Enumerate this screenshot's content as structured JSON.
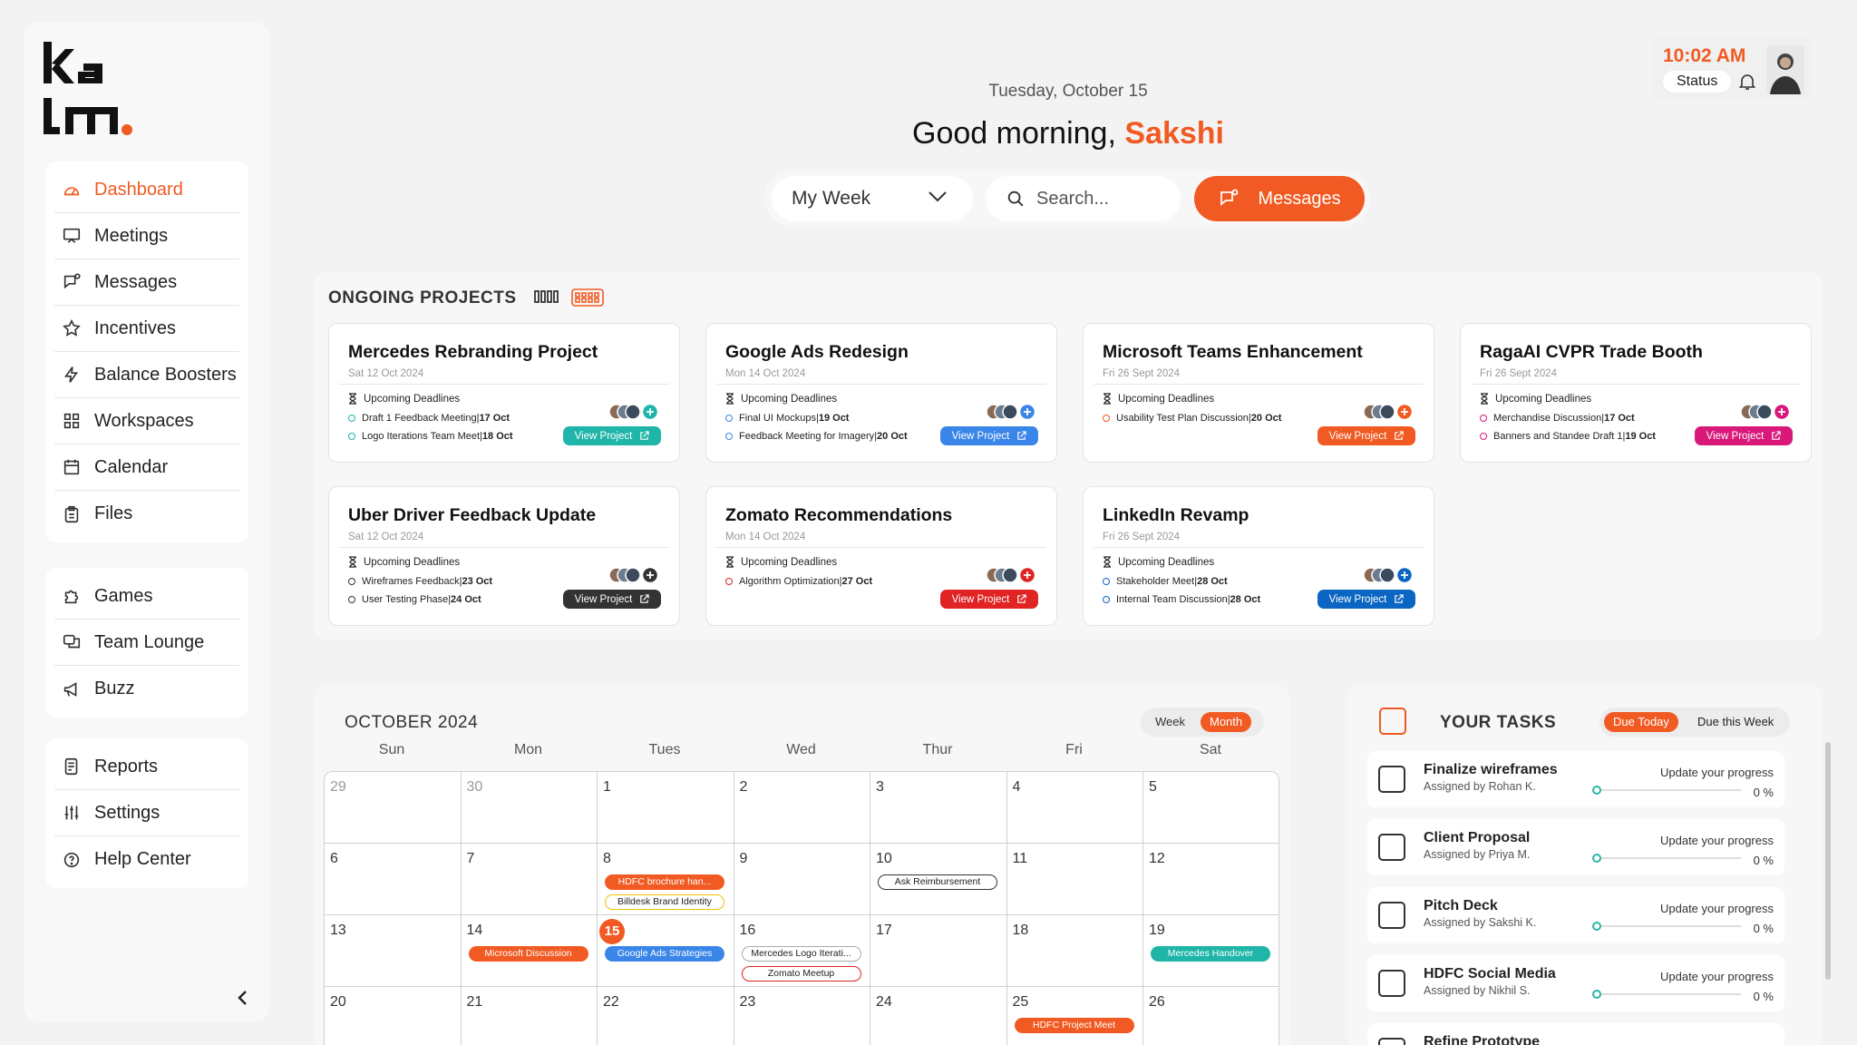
{
  "brand": {
    "logo_text_top": "ka",
    "logo_text_bottom": "lm",
    "accent": "#f15a22"
  },
  "sidebar": {
    "group1": [
      {
        "label": "Dashboard",
        "icon": "dashboard-icon",
        "active": true
      },
      {
        "label": "Meetings",
        "icon": "meetings-icon"
      },
      {
        "label": "Messages",
        "icon": "messages-icon"
      },
      {
        "label": "Incentives",
        "icon": "star-icon"
      },
      {
        "label": "Balance Boosters",
        "icon": "bolt-icon"
      },
      {
        "label": "Workspaces",
        "icon": "grid-icon"
      },
      {
        "label": "Calendar",
        "icon": "calendar-icon"
      },
      {
        "label": "Files",
        "icon": "files-icon"
      }
    ],
    "group2": [
      {
        "label": "Games",
        "icon": "puzzle-icon"
      },
      {
        "label": "Team Lounge",
        "icon": "lounge-icon"
      },
      {
        "label": "Buzz",
        "icon": "megaphone-icon"
      }
    ],
    "group3": [
      {
        "label": "Reports",
        "icon": "reports-icon"
      },
      {
        "label": "Settings",
        "icon": "sliders-icon"
      },
      {
        "label": "Help Center",
        "icon": "help-icon"
      }
    ]
  },
  "header": {
    "date": "Tuesday, October 15",
    "greeting": "Good morning,",
    "name": "Sakshi",
    "week_select": "My Week",
    "search_placeholder": "Search...",
    "messages_button": "Messages",
    "time": "10:02 AM",
    "status": "Status"
  },
  "projects": {
    "heading": "ONGOING PROJECTS",
    "upcoming_label": "Upcoming Deadlines",
    "view_label": "View Project",
    "cards": [
      {
        "title": "Mercedes Rebranding Project",
        "date": "Sat  12 Oct 2024",
        "color": "#1fb5a8",
        "dot": "#1fb5a8",
        "deadlines": [
          [
            "Draft 1 Feedback Meeting",
            "17 Oct"
          ],
          [
            "Logo Iterations Team Meet",
            "18 Oct"
          ]
        ]
      },
      {
        "title": "Google Ads Redesign",
        "date": "Mon  14 Oct 2024",
        "color": "#3a86e8",
        "dot": "#3a86e8",
        "deadlines": [
          [
            "Final UI Mockups",
            "19 Oct"
          ],
          [
            "Feedback Meeting for Imagery",
            "20 Oct"
          ]
        ]
      },
      {
        "title": "Microsoft Teams Enhancement",
        "date": "Fri  26 Sept 2024",
        "color": "#f15a22",
        "dot": "#f15a22",
        "deadlines": [
          [
            "Usability Test Plan Discussion",
            "20 Oct"
          ]
        ]
      },
      {
        "title": "RagaAI CVPR Trade Booth",
        "date": "Fri  26 Sept 2024",
        "color": "#d9197a",
        "dot": "#d9197a",
        "deadlines": [
          [
            "Merchandise Discussion",
            "17 Oct"
          ],
          [
            "Banners and Standee Draft 1",
            "19 Oct"
          ]
        ]
      },
      {
        "title": "Uber Driver Feedback Update",
        "date": "Sat  12 Oct 2024",
        "color": "#333333",
        "dot": "#333333",
        "deadlines": [
          [
            "Wireframes Feedback",
            "23 Oct"
          ],
          [
            "User Testing Phase",
            "24 Oct"
          ]
        ]
      },
      {
        "title": "Zomato Recommendations",
        "date": "Mon  14 Oct 2024",
        "color": "#e02424",
        "dot": "#e02424",
        "deadlines": [
          [
            "Algorithm Optimization",
            "27 Oct"
          ]
        ]
      },
      {
        "title": "LinkedIn Revamp",
        "date": "Fri  26 Sept 2024",
        "color": "#0a66c2",
        "dot": "#0a66c2",
        "deadlines": [
          [
            "Stakeholder Meet",
            "28 Oct"
          ],
          [
            "Internal Team Discussion",
            "28 Oct"
          ]
        ]
      }
    ]
  },
  "calendar": {
    "title": "OCTOBER  2024",
    "view_week": "Week",
    "view_month": "Month",
    "weekdays": [
      "Sun",
      "Mon",
      "Tues",
      "Wed",
      "Thur",
      "Fri",
      "Sat"
    ],
    "weeks": [
      [
        {
          "d": "29",
          "muted": true
        },
        {
          "d": "30",
          "muted": true
        },
        {
          "d": "1"
        },
        {
          "d": "2"
        },
        {
          "d": "3"
        },
        {
          "d": "4"
        },
        {
          "d": "5"
        }
      ],
      [
        {
          "d": "6"
        },
        {
          "d": "7"
        },
        {
          "d": "8",
          "events": [
            {
              "t": "HDFC brochure han...",
              "s": "fill",
              "c": "#f15a22"
            },
            {
              "t": "Billdesk Brand Identity",
              "s": "outline",
              "c": "#f0c000"
            }
          ]
        },
        {
          "d": "9"
        },
        {
          "d": "10",
          "events": [
            {
              "t": "Ask Reimbursement",
              "s": "outline",
              "c": "#333333"
            }
          ]
        },
        {
          "d": "11"
        },
        {
          "d": "12"
        }
      ],
      [
        {
          "d": "13"
        },
        {
          "d": "14",
          "events": [
            {
              "t": "Microsoft Discussion",
              "s": "fill",
              "c": "#f15a22"
            }
          ]
        },
        {
          "d": "15",
          "today": true,
          "events": [
            {
              "t": "Google Ads Strategies",
              "s": "fill",
              "c": "#3a86e8"
            }
          ]
        },
        {
          "d": "16",
          "events": [
            {
              "t": "Mercedes Logo Iterati...",
              "s": "outline",
              "c": "#aaaaaa"
            },
            {
              "t": "Zomato Meetup",
              "s": "outline",
              "c": "#e02424"
            }
          ]
        },
        {
          "d": "17"
        },
        {
          "d": "18"
        },
        {
          "d": "19",
          "events": [
            {
              "t": "Mercedes Handover",
              "s": "fill",
              "c": "#1fb5a8"
            }
          ]
        }
      ],
      [
        {
          "d": "20"
        },
        {
          "d": "21"
        },
        {
          "d": "22"
        },
        {
          "d": "23"
        },
        {
          "d": "24"
        },
        {
          "d": "25",
          "events": [
            {
              "t": "HDFC Project Meet",
              "s": "fill",
              "c": "#f15a22"
            }
          ]
        },
        {
          "d": "26"
        }
      ]
    ]
  },
  "tasks": {
    "heading": "YOUR TASKS",
    "tab_today": "Due Today",
    "tab_week": "Due this Week",
    "progress_label": "Update your progress",
    "items": [
      {
        "name": "Finalize wireframes",
        "assigned": "Assigned by Rohan K.",
        "pct": "0 %"
      },
      {
        "name": "Client Proposal",
        "assigned": "Assigned by Priya M.",
        "pct": "0 %"
      },
      {
        "name": "Pitch Deck",
        "assigned": "Assigned by Sakshi K.",
        "pct": "0 %"
      },
      {
        "name": "HDFC Social Media",
        "assigned": "Assigned by Nikhil S.",
        "pct": "0 %"
      },
      {
        "name": "Refine Prototype",
        "assigned": "",
        "pct": ""
      }
    ]
  }
}
